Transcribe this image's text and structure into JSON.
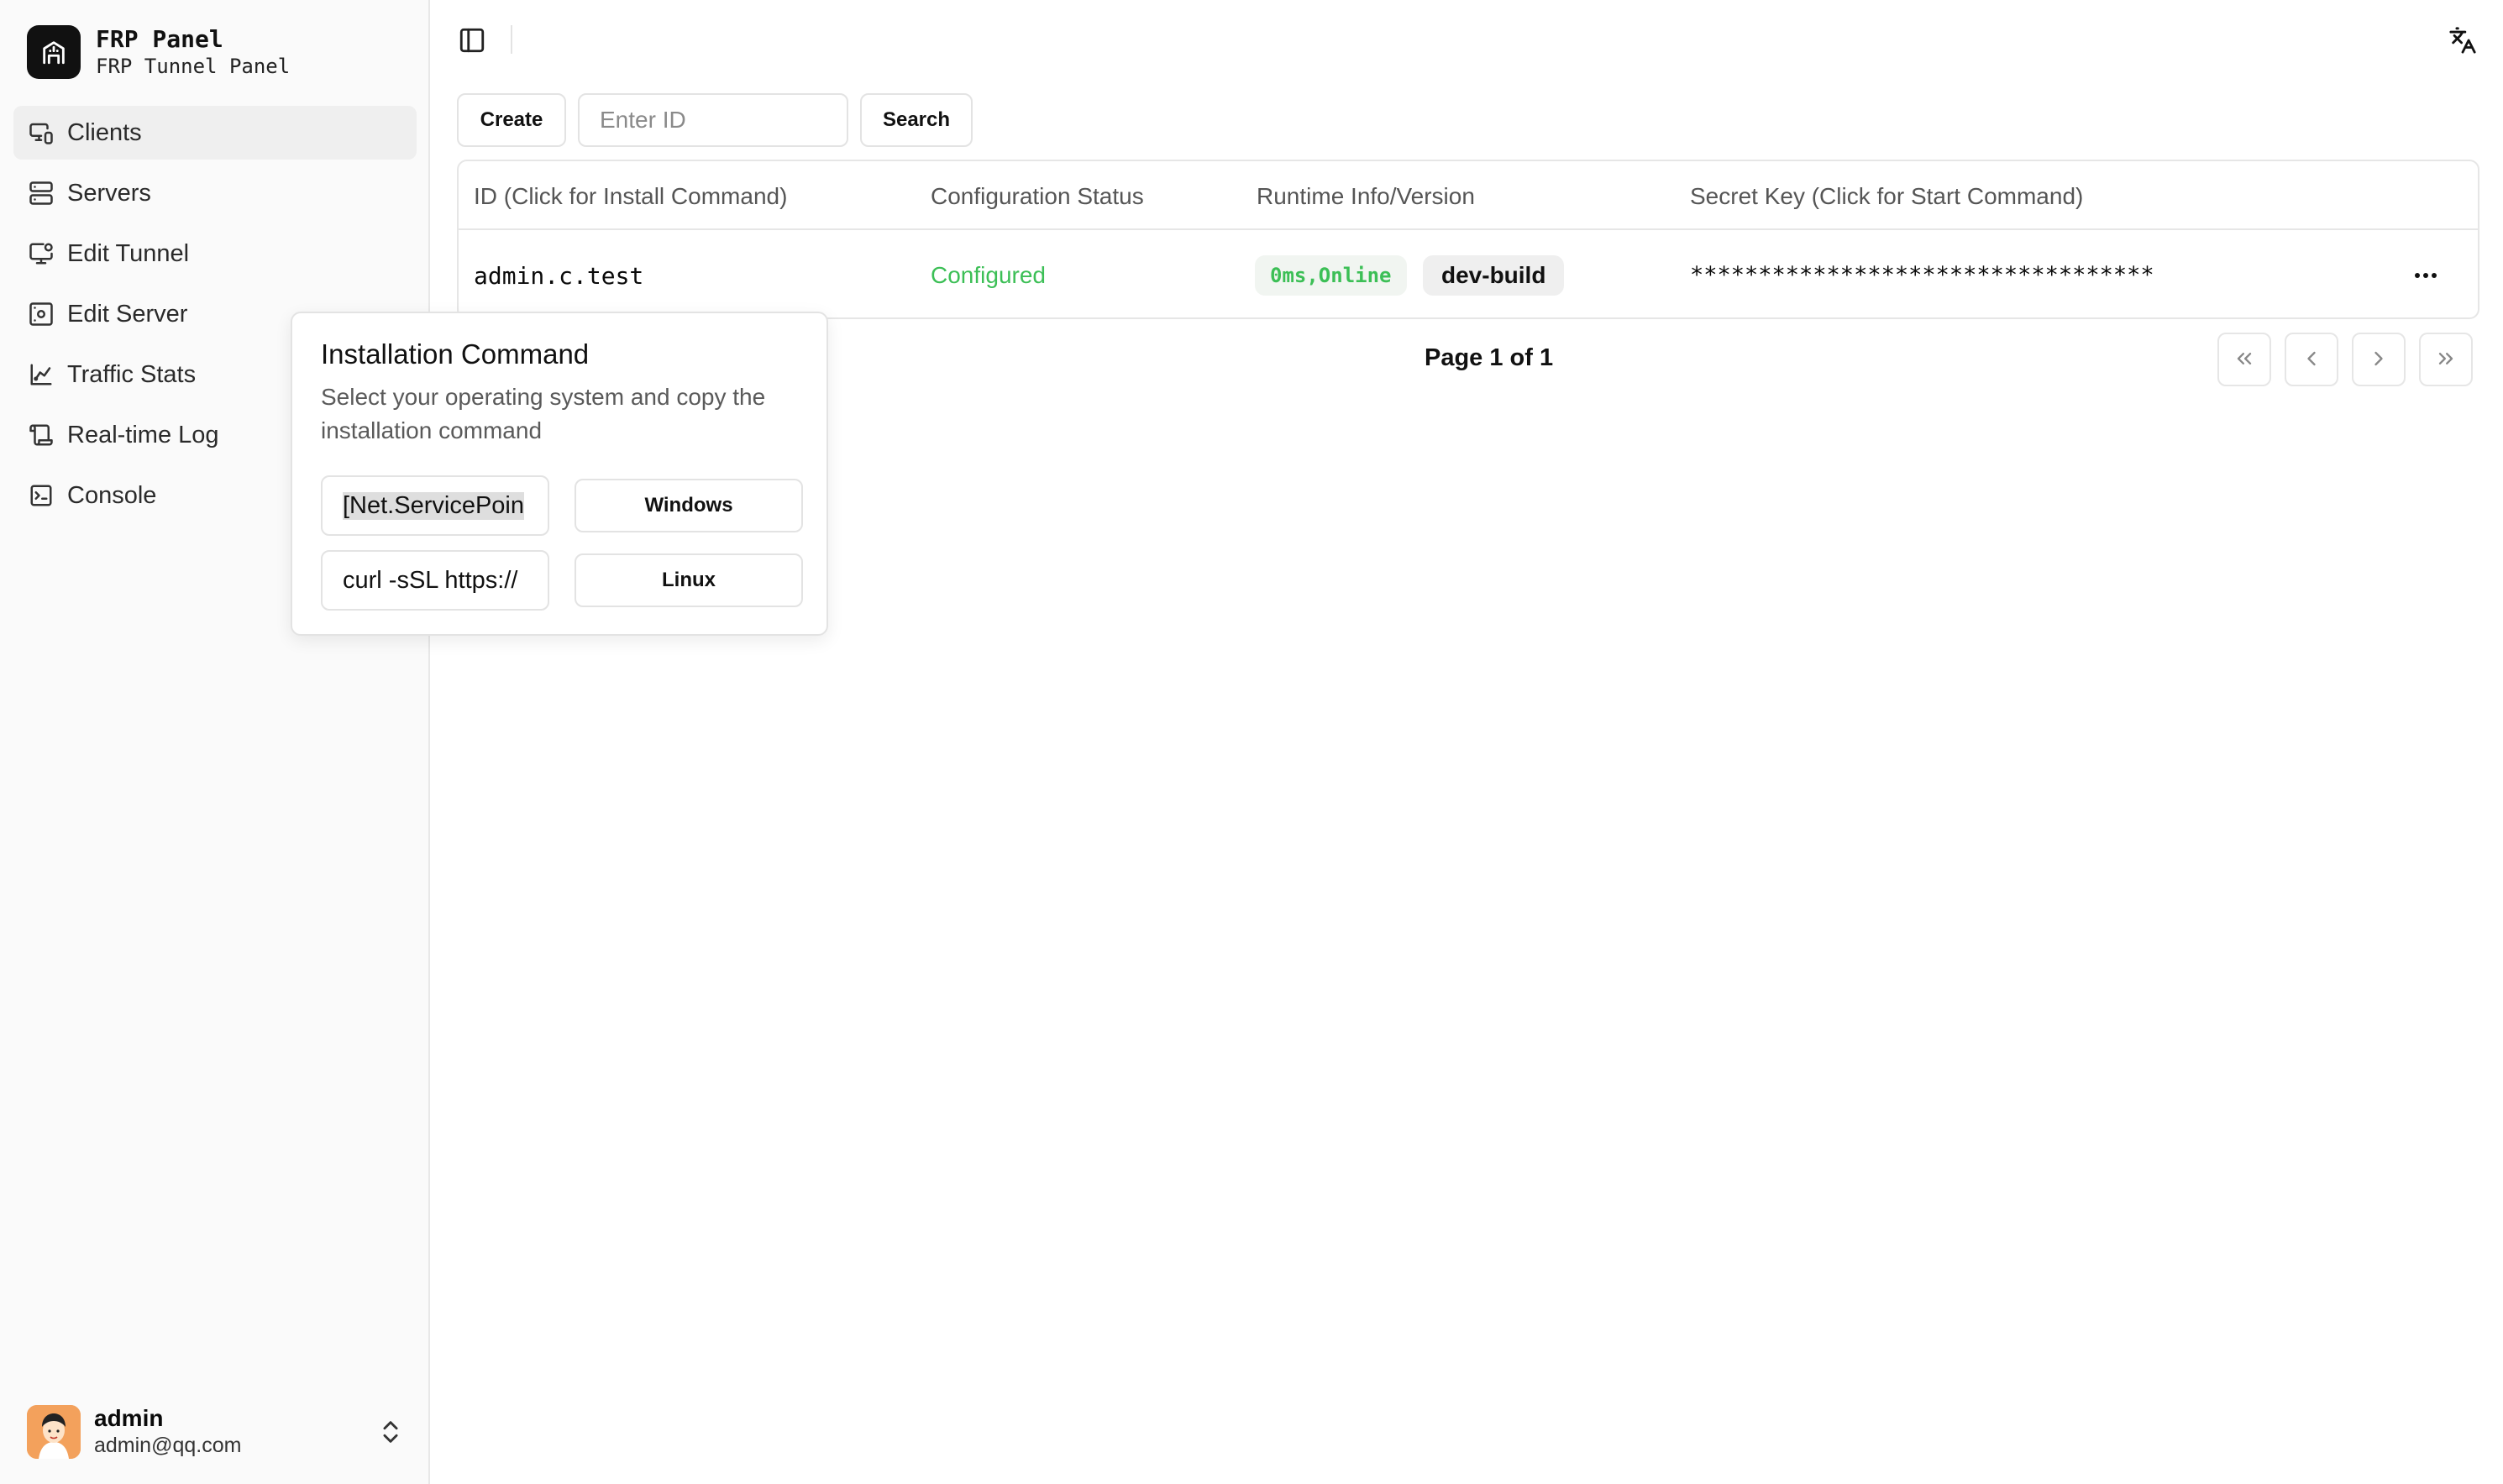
{
  "app": {
    "name": "FRP Panel",
    "subtitle": "FRP Tunnel Panel"
  },
  "sidebar": {
    "items": [
      {
        "label": "Clients",
        "icon": "monitor-smartphone-icon",
        "active": true
      },
      {
        "label": "Servers",
        "icon": "server-icon",
        "active": false
      },
      {
        "label": "Edit Tunnel",
        "icon": "monitor-cog-icon",
        "active": false
      },
      {
        "label": "Edit Server",
        "icon": "server-cog-icon",
        "active": false
      },
      {
        "label": "Traffic Stats",
        "icon": "chart-icon",
        "active": false
      },
      {
        "label": "Real-time Log",
        "icon": "scroll-icon",
        "active": false
      },
      {
        "label": "Console",
        "icon": "terminal-icon",
        "active": false
      }
    ]
  },
  "user": {
    "name": "admin",
    "email": "admin@qq.com"
  },
  "toolbar": {
    "create_label": "Create",
    "search_placeholder": "Enter ID",
    "search_value": "",
    "search_label": "Search"
  },
  "table": {
    "columns": [
      "ID (Click for Install Command)",
      "Configuration Status",
      "Runtime Info/Version",
      "Secret Key (Click for Start Command)"
    ],
    "rows": [
      {
        "id": "admin.c.test",
        "status": "Configured",
        "runtime": "0ms,Online",
        "version": "dev-build",
        "secret": "**********************************"
      }
    ]
  },
  "pagination": {
    "text": "Page 1 of 1"
  },
  "popover": {
    "title": "Installation Command",
    "description": "Select your operating system and copy the installation command",
    "windows_cmd": "[Net.ServicePoin",
    "linux_cmd": "curl -sSL https://",
    "windows_label": "Windows",
    "linux_label": "Linux"
  },
  "colors": {
    "accent_online": "#3cbf56",
    "status_configured": "#3cbf56",
    "sidebar_bg": "#fafafa",
    "active_nav_bg": "#efefef"
  }
}
